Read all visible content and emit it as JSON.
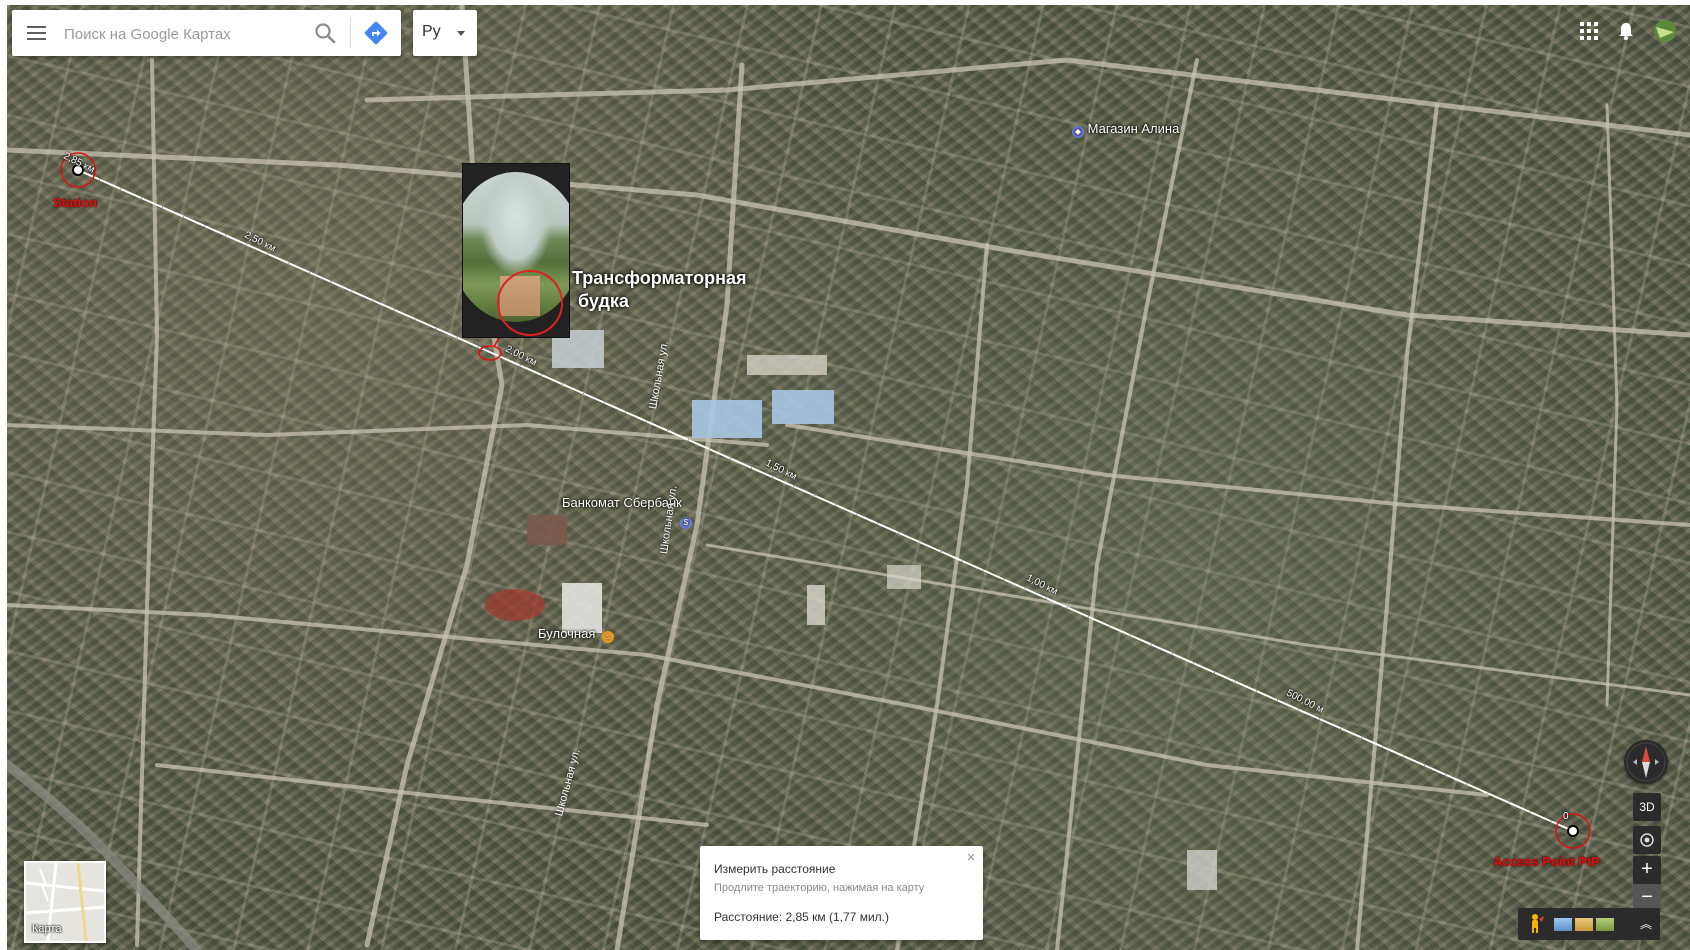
{
  "search": {
    "placeholder": "Поиск на Google Картах",
    "value": ""
  },
  "language": {
    "selected": "Ру"
  },
  "map": {
    "places": [
      {
        "name": "Магазин Алина",
        "icon": "shop-pin-icon",
        "color": "#6b7bd6"
      },
      {
        "name": "Банкомат Сбербанк",
        "icon": "atm-pin-icon",
        "color": "#6b7bd6"
      },
      {
        "name": "Булочная",
        "icon": "bakery-pin-icon",
        "color": "#f09a1c"
      }
    ],
    "streets": [
      {
        "name": "Школьная ул."
      },
      {
        "name": "Школьная ул."
      },
      {
        "name": "Школьная ул."
      }
    ],
    "measure_line": {
      "start_label": "Station",
      "end_label": "Access Point PtP",
      "ticks": [
        "2,85 км",
        "2,50 км",
        "2,00 км",
        "1,50 км",
        "1,00 км",
        "500,00 м",
        "0"
      ]
    },
    "annotation": {
      "line1": "Трансформаторная",
      "line2": "будка"
    },
    "colors": {
      "measure_line": "#ffffff",
      "endpoint_marker": "#e01010"
    }
  },
  "controls": {
    "tilt_label": "3D",
    "zoom_in_label": "+",
    "zoom_out_label": "−",
    "map_type_label": "Карта",
    "expand_label": "︽"
  },
  "measure_card": {
    "title": "Измерить расстояние",
    "hint": "Продлите траекторию, нажимая на карту",
    "distance": "Расстояние: 2,85 км (1,77 мил.)"
  }
}
